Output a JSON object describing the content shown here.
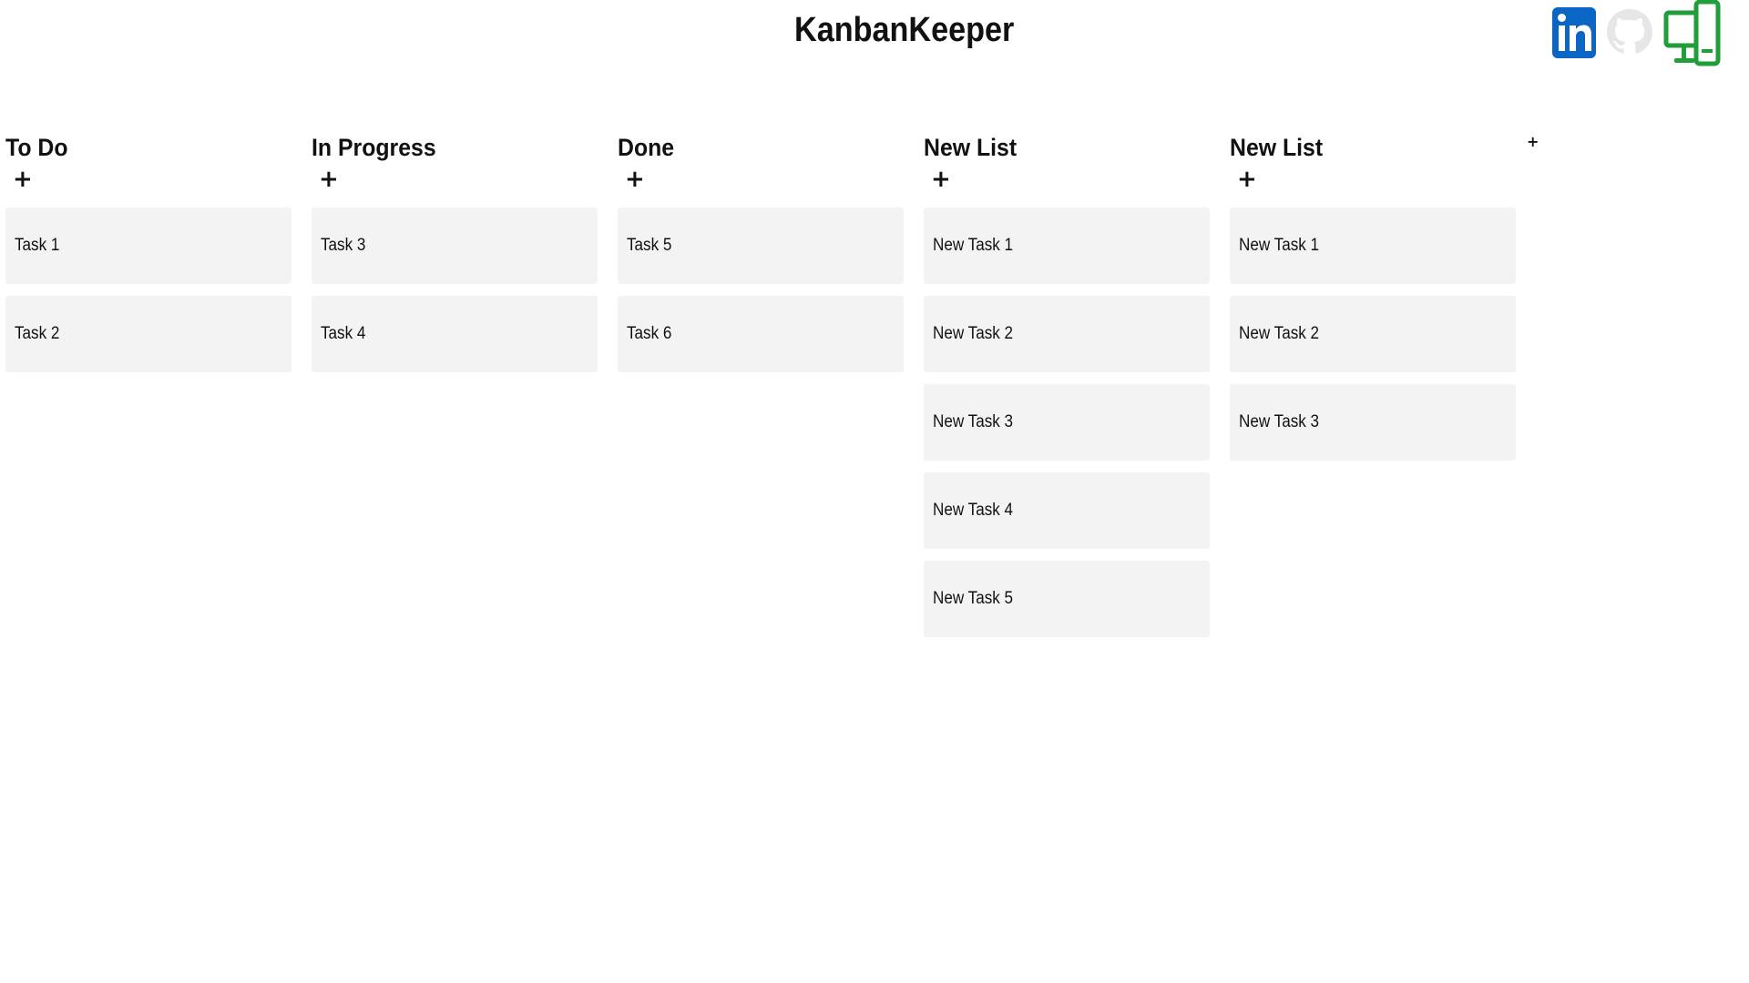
{
  "header": {
    "title": "KanbanKeeper"
  },
  "social": {
    "linkedin_icon": "linkedin-icon",
    "github_icon": "github-icon",
    "devices_icon": "devices-icon",
    "linkedin_color": "#0a66c2",
    "github_color": "#e6e6e6",
    "devices_color": "#1f9e3a"
  },
  "board": {
    "add_list_label": "+",
    "columns": [
      {
        "title": "To Do",
        "add_label": "+",
        "tasks": [
          "Task 1",
          "Task 2"
        ]
      },
      {
        "title": "In Progress",
        "add_label": "+",
        "tasks": [
          "Task 3",
          "Task 4"
        ]
      },
      {
        "title": "Done",
        "add_label": "+",
        "tasks": [
          "Task 5",
          "Task 6"
        ]
      },
      {
        "title": "New List",
        "add_label": "+",
        "tasks": [
          "New Task 1",
          "New Task 2",
          "New Task 3",
          "New Task 4",
          "New Task 5"
        ]
      },
      {
        "title": "New List",
        "add_label": "+",
        "tasks": [
          "New Task 1",
          "New Task 2",
          "New Task 3"
        ]
      }
    ]
  },
  "colors": {
    "card_background": "#f3f3f3",
    "page_background": "#ffffff",
    "text": "#111111"
  }
}
